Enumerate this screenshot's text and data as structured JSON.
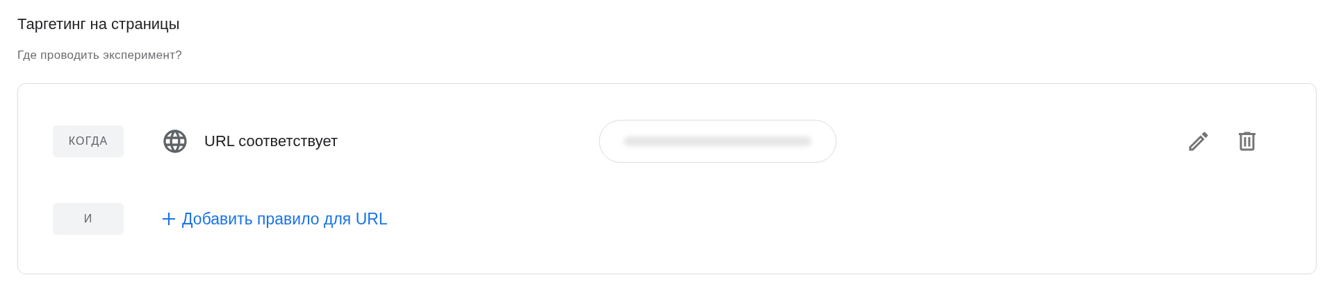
{
  "section": {
    "title": "Таргетинг на страницы",
    "subtitle": "Где проводить эксперимент?"
  },
  "rules": [
    {
      "kind": "condition",
      "operator": "КОГДА",
      "label": "URL соответствует"
    }
  ],
  "add_row": {
    "operator": "И",
    "link": "Добавить правило для URL"
  }
}
